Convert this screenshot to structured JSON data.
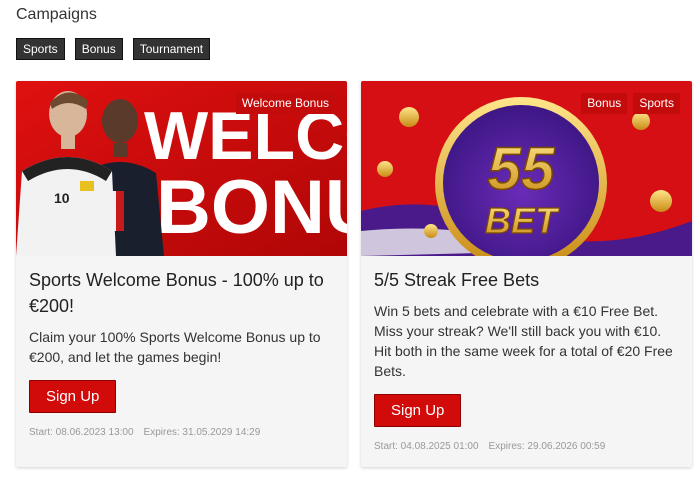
{
  "section": {
    "title": "Campaigns"
  },
  "filters": [
    {
      "label": "Sports"
    },
    {
      "label": "Bonus"
    },
    {
      "label": "Tournament"
    }
  ],
  "cards": [
    {
      "banner_text": {
        "line1": "WELCOM",
        "line2": "BONU"
      },
      "jersey_number": "10",
      "tags": [
        "Welcome Bonus"
      ],
      "title": "Sports Welcome Bonus - 100% up to €200!",
      "description": "Claim your 100% Sports Welcome Bonus up to €200, and let the games begin!",
      "button": "Sign Up",
      "start": "Start: 08.06.2023 13:00",
      "expires": "Expires: 31.05.2029 14:29"
    },
    {
      "banner_text": {
        "line1": "55",
        "line2": "BET"
      },
      "tags": [
        "Bonus",
        "Sports"
      ],
      "title": "5/5 Streak Free Bets",
      "description": "Win 5 bets and celebrate with a €10 Free Bet. Miss your streak? We'll still back you with €10. Hit both in the same week for a total of €20 Free Bets.",
      "button": "Sign Up",
      "start": "Start: 04.08.2025 01:00",
      "expires": "Expires: 29.06.2026 00:59"
    }
  ],
  "colors": {
    "accent": "#d10a0a",
    "chip_bg": "#333333",
    "card_bg": "#f5f5f5"
  }
}
